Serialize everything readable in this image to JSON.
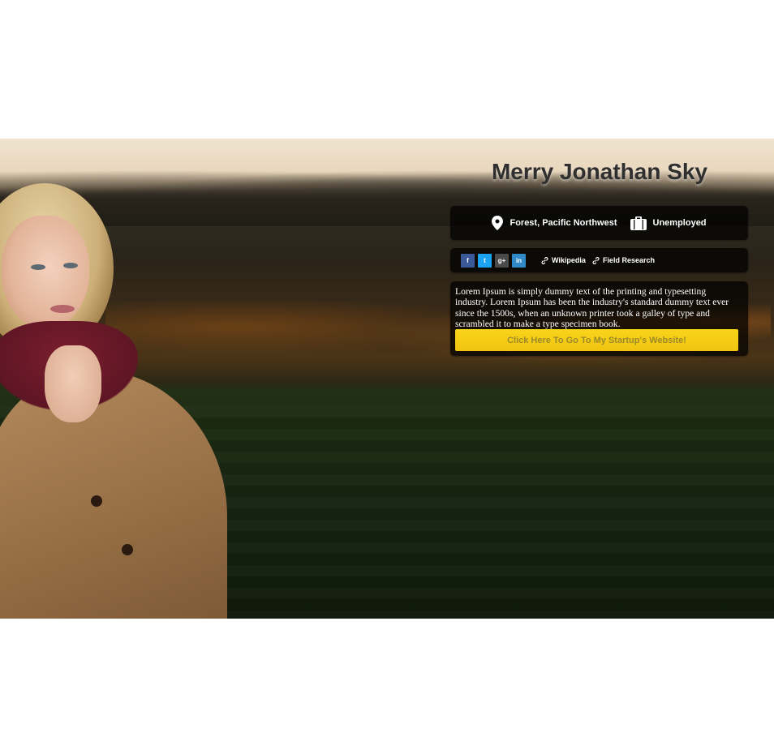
{
  "profile": {
    "name": "Merry Jonathan Sky",
    "location": "Forest, Pacific Northwest",
    "occupation": "Unemployed"
  },
  "social": {
    "icons": [
      {
        "name": "facebook-icon",
        "glyph": "f",
        "color": "#3b5998"
      },
      {
        "name": "twitter-icon",
        "glyph": "t",
        "color": "#1da1f2"
      },
      {
        "name": "google-plus-icon",
        "glyph": "g+",
        "color": "#4a4a4a"
      },
      {
        "name": "linkedin-icon",
        "glyph": "in",
        "color": "#2f8ac7"
      }
    ],
    "links": [
      {
        "label": "Wikipedia"
      },
      {
        "label": "Field Research"
      }
    ]
  },
  "bio": {
    "text": "Lorem Ipsum is simply dummy text of the printing and typesetting industry. Lorem Ipsum has been the industry's standard dummy text ever since the 1500s, when an unknown printer took a galley of type and scrambled it to make a type specimen book.",
    "cta_label": "Click Here To Go To My Startup's Website!"
  },
  "colors": {
    "accent": "#f5cc16",
    "panel": "rgba(0,0,0,0.72)"
  }
}
